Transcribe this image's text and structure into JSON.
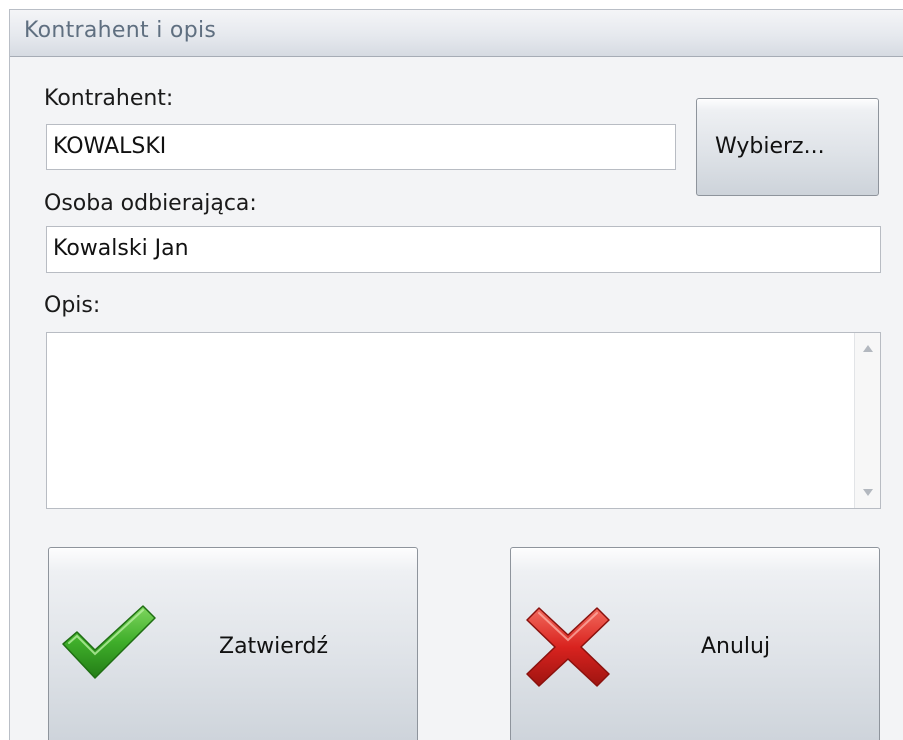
{
  "window": {
    "title": "Kontrahent i opis"
  },
  "form": {
    "kontrahent_label": "Kontrahent:",
    "kontrahent_value": "KOWALSKI",
    "wybierz_label": "Wybierz...",
    "osoba_label": "Osoba odbierająca:",
    "osoba_value": "Kowalski Jan",
    "opis_label": "Opis:",
    "opis_value": ""
  },
  "actions": {
    "confirm_label": "Zatwierdź",
    "confirm_icon": "checkmark-icon",
    "cancel_label": "Anuluj",
    "cancel_icon": "red-x-icon"
  },
  "colors": {
    "title_text": "#5f6f80",
    "check_green": "#3fae2a",
    "cross_red": "#d9231f"
  }
}
